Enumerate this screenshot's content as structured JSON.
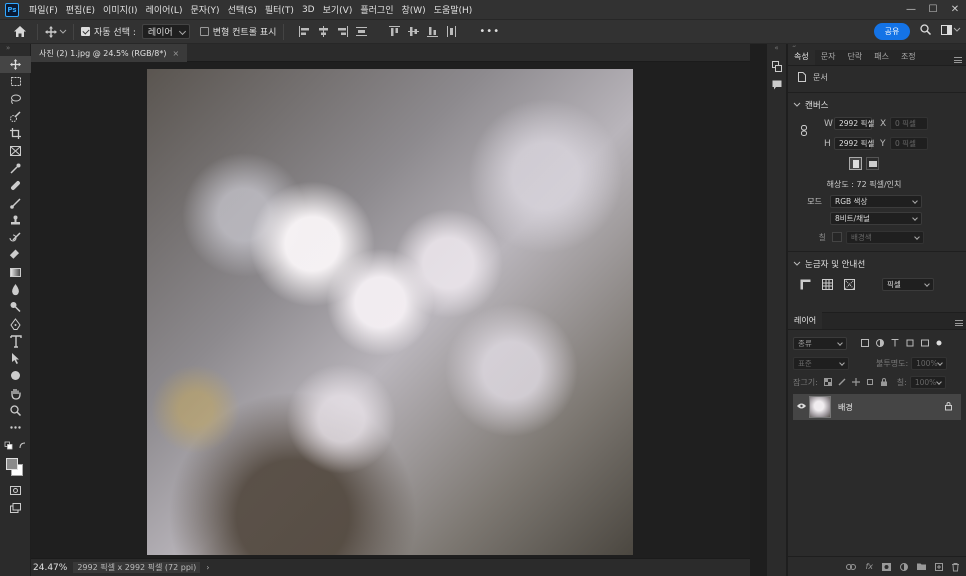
{
  "app": {
    "logo": "Ps"
  },
  "menu": [
    "파일(F)",
    "편집(E)",
    "이미지(I)",
    "레이어(L)",
    "문자(Y)",
    "선택(S)",
    "필터(T)",
    "3D",
    "보기(V)",
    "플러그인",
    "창(W)",
    "도움말(H)"
  ],
  "window_controls": {
    "minimize": "—",
    "maximize": "☐",
    "close": "✕"
  },
  "options": {
    "auto_select_label": "자동 선택 :",
    "auto_select_value": "레이어",
    "transform_controls_label": "변형 컨트롤 표시",
    "more": "•••",
    "share_label": "공유"
  },
  "document": {
    "tab_title": "사진 (2) 1.jpg @ 24.5% (RGB/8*)",
    "tab_close": "×",
    "zoom": "24.47%",
    "info": "2992 픽셀 x 2992 픽셀 (72 ppi)",
    "status_arrow": "›"
  },
  "properties_panel": {
    "tabs": [
      "속성",
      "문자",
      "단락",
      "패스",
      "조정"
    ],
    "doc_label": "문서",
    "canvas_section": "캔버스",
    "width_label": "W",
    "width_value": "2992 픽셀",
    "height_label": "H",
    "height_value": "2992 픽셀",
    "x_label": "X",
    "x_placeholder": "0 픽셀",
    "y_label": "Y",
    "y_placeholder": "0 픽셀",
    "resolution": "해상도 : 72 픽셀/인치",
    "mode_label": "모드",
    "mode_value": "RGB 색상",
    "depth_value": "8비트/채널",
    "fill_label": "칠",
    "fill_value": "배경색",
    "rulers_section": "눈금자 및 안내선",
    "units_value": "픽셀"
  },
  "layers_panel": {
    "tab": "레이어",
    "filter_label": "종류",
    "blend_mode": "표준",
    "opacity_label": "불투명도:",
    "opacity_value": "100%",
    "lock_label": "잠그기:",
    "fill_label": "칠:",
    "fill_value": "100%",
    "layers": [
      {
        "name": "배경",
        "visible": true,
        "locked": true
      }
    ],
    "bottom_icons": [
      "link-icon",
      "fx-icon",
      "mask-icon",
      "adjustment-icon",
      "folder-icon",
      "new-layer-icon",
      "trash-icon"
    ]
  },
  "colors": {
    "accent": "#1473e6",
    "panel": "#2b2b2b",
    "bar": "#323232",
    "canvas": "#1f1f1f"
  }
}
